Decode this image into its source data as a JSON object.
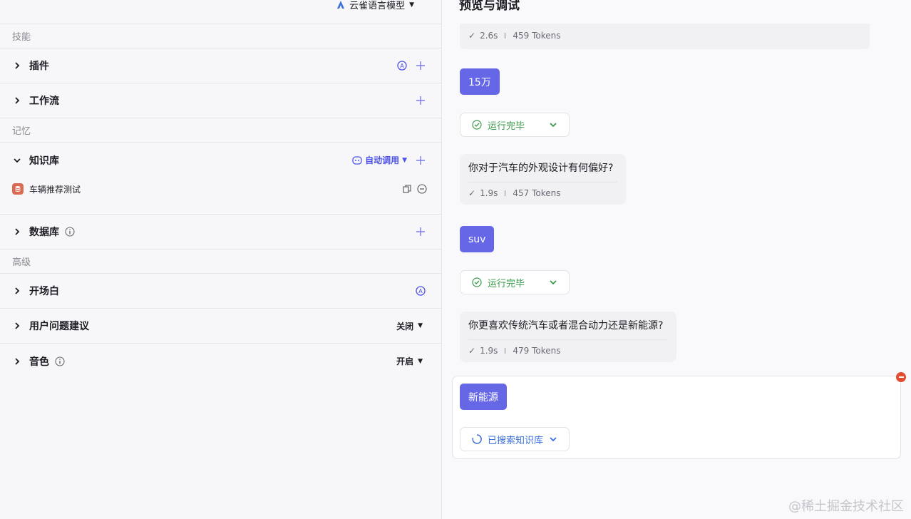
{
  "left": {
    "model": {
      "label": "云雀语言模型"
    },
    "sections": {
      "skills": "技能",
      "memory": "记忆",
      "advanced": "高级"
    },
    "rows": {
      "plugin": "插件",
      "workflow": "工作流",
      "knowledge": "知识库",
      "database": "数据库",
      "opening": "开场白",
      "suggest": "用户问题建议",
      "voice": "音色"
    },
    "knowledge_auto": "自动调用",
    "knowledge_items": [
      "车辆推荐测试"
    ],
    "suggest_value": "关闭",
    "voice_value": "开启"
  },
  "right": {
    "title": "预览与调试",
    "messages": {
      "m0_meta_time": "2.6s",
      "m0_meta_tokens": "459 Tokens",
      "u1": "15万",
      "status_done": "运行完毕",
      "b1_text": "你对于汽车的外观设计有何偏好?",
      "b1_time": "1.9s",
      "b1_tokens": "457 Tokens",
      "u2": "suv",
      "b2_text": "你更喜欢传统汽车或者混合动力还是新能源?",
      "b2_time": "1.9s",
      "b2_tokens": "479 Tokens",
      "u3": "新能源",
      "status_searching": "已搜索知识库"
    }
  },
  "watermark": "@稀土掘金技术社区",
  "colors": {
    "accent": "#4d53e8",
    "user_bubble": "#6667e7",
    "success": "#3a9a4a",
    "searching": "#3b6fd8",
    "danger": "#e24d32"
  }
}
